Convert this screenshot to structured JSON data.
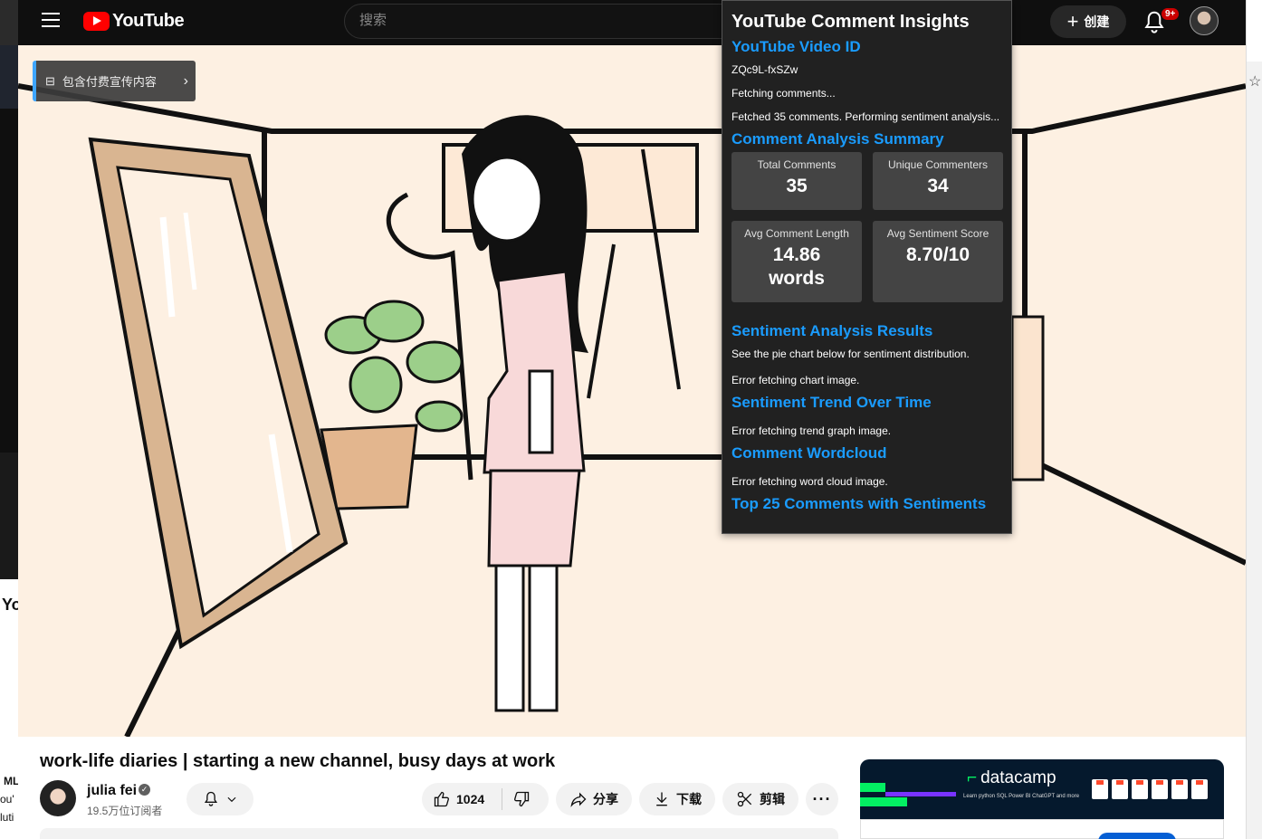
{
  "topbar": {
    "logo_text": "YouTube",
    "search_placeholder": "搜索",
    "create_label": "创建",
    "notification_badge": "9+"
  },
  "video": {
    "paid_promo_label": "包含付费宣传内容"
  },
  "extension_panel": {
    "title": "YouTube Comment Insights",
    "video_id_heading": "YouTube Video ID",
    "video_id": "ZQc9L-fxSZw",
    "status_1": "Fetching comments...",
    "status_2": "Fetched 35 comments. Performing sentiment analysis...",
    "summary_heading": "Comment Analysis Summary",
    "stats": [
      {
        "label": "Total Comments",
        "value": "35"
      },
      {
        "label": "Unique Commenters",
        "value": "34"
      },
      {
        "label": "Avg Comment Length",
        "value": "14.86 words"
      },
      {
        "label": "Avg Sentiment Score",
        "value": "8.70/10"
      }
    ],
    "sentiment_heading": "Sentiment Analysis Results",
    "sentiment_note": "See the pie chart below for sentiment distribution.",
    "chart_error": "Error fetching chart image.",
    "trend_heading": "Sentiment Trend Over Time",
    "trend_error": "Error fetching trend graph image.",
    "wordcloud_heading": "Comment Wordcloud",
    "wordcloud_error": "Error fetching word cloud image.",
    "top_comments_heading": "Top 25 Comments with Sentiments"
  },
  "video_info": {
    "title": "work-life diaries | starting a new channel, busy days at work",
    "channel_name": "julia fei",
    "subscribers": "19.5万位订阅者",
    "like_count": "1024",
    "share_label": "分享",
    "download_label": "下载",
    "clip_label": "剪辑",
    "more_label": "···"
  },
  "ad": {
    "brand": "datacamp",
    "sub_text": "Learn  python  SQL  Power BI  ChatGPT  and more"
  },
  "background_window": {
    "fragment_1": "Yo",
    "fragment_2": "ML",
    "fragment_3": "ou'",
    "fragment_4": "luti"
  },
  "colors": {
    "accent_blue": "#1a9cff",
    "youtube_red": "#ff0000",
    "panel_bg": "#212121",
    "datacamp_green": "#03ef62"
  }
}
